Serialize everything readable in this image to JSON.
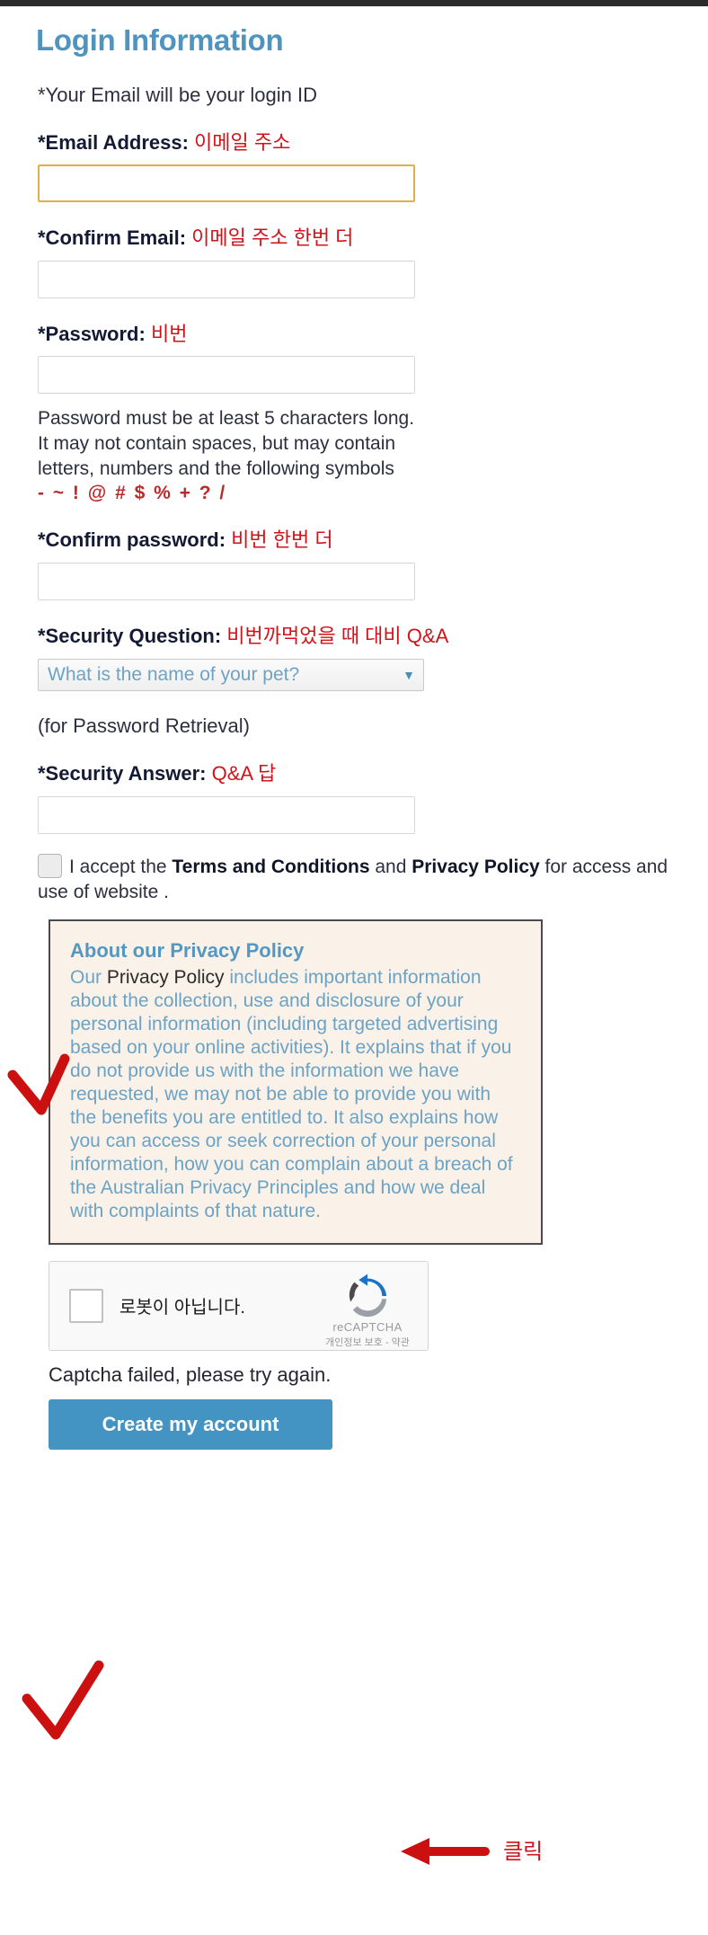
{
  "page": {
    "title": "Login Information",
    "email_hint": "*Your Email will be your login ID"
  },
  "fields": {
    "email": {
      "label": "*Email Address:",
      "annotation_kr": "이메일 주소",
      "value": "",
      "focused": true
    },
    "confirm_email": {
      "label": "*Confirm Email:",
      "annotation_kr": "이메일 주소 한번 더",
      "value": ""
    },
    "password": {
      "label": "*Password:",
      "annotation_kr": "비번",
      "value": "",
      "rules_line1": "Password must be at least 5 characters long.",
      "rules_line2": "It may not contain spaces, but may contain",
      "rules_line3": "letters, numbers and the following symbols",
      "symbols": "- ~ ! @ # $ % + ? /"
    },
    "confirm_password": {
      "label": "*Confirm password:",
      "annotation_kr": "비번 한번 더",
      "value": ""
    },
    "security_question": {
      "label": "*Security Question:",
      "annotation_kr": "비번까먹었을 때 대비 Q&A",
      "selected": "What is the name of your pet?",
      "note": "(for Password Retrieval)"
    },
    "security_answer": {
      "label": "*Security Answer:",
      "annotation_kr": "Q&A 답",
      "value": ""
    }
  },
  "terms": {
    "checkbox_checked": false,
    "text_before": "I accept the ",
    "bold1": "Terms and Conditions",
    "text_mid": " and ",
    "bold2": "Privacy Policy",
    "text_after": " for access and use of website ."
  },
  "privacy": {
    "title": "About our Privacy Policy",
    "lead_1": "Our ",
    "lead_dark": "Privacy Policy",
    "body": " includes important information about the collection, use and disclosure of your personal information (including targeted advertising based on your online activities). It explains that if you do not provide us with the information we have requested, we may not be able to provide you with the benefits you are entitled to. It also explains how you can access or seek correction of your personal information, how you can complain about a breach of the Australian Privacy Principles and how we deal with complaints of that nature."
  },
  "captcha": {
    "label": "로봇이 아닙니다.",
    "brand": "reCAPTCHA",
    "links": "개인정보 보호 - 약관",
    "error": "Captcha failed, please try again.",
    "checked": false
  },
  "submit": {
    "label": "Create my account"
  },
  "annotations": {
    "click_kr": "클릭"
  },
  "colors": {
    "heading": "#4f93bf",
    "annotation_red": "#d0131a",
    "button_blue": "#4393c3",
    "privacy_bg": "#faf2e9",
    "focus_border": "#d9b34a"
  }
}
